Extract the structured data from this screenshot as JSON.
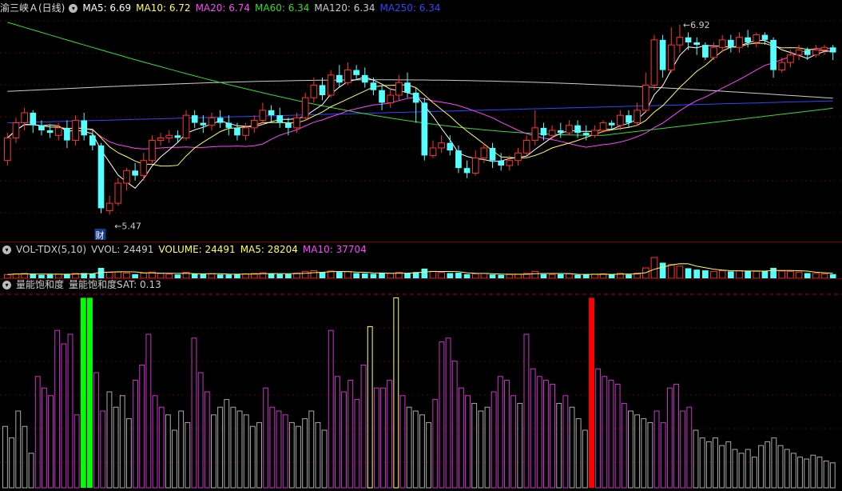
{
  "main_legend": {
    "stock": "渝三峡Ａ(日线)",
    "items": [
      {
        "label": "MA5: 6.69",
        "color": "#ffffff"
      },
      {
        "label": "MA10: 6.72",
        "color": "#ffff55"
      },
      {
        "label": "MA20: 6.74",
        "color": "#ff44ff"
      },
      {
        "label": "MA60: 6.34",
        "color": "#33dd33"
      },
      {
        "label": "MA120: 6.34",
        "color": "#cccccc"
      },
      {
        "label": "MA250: 6.34",
        "color": "#3344ff"
      }
    ]
  },
  "vol_legend": {
    "items": [
      {
        "label": "VOL-TDX(5,10)",
        "color": "#cccccc"
      },
      {
        "label": "VVOL: 24491",
        "color": "#cccccc"
      },
      {
        "label": "VOLUME: 24491",
        "color": "#ffff55"
      },
      {
        "label": "MA5: 28204",
        "color": "#ffff55"
      },
      {
        "label": "MA10: 37704",
        "color": "#ff44ff"
      }
    ]
  },
  "sat_legend": {
    "items": [
      {
        "label": "量能饱和度",
        "color": "#cccccc"
      },
      {
        "label": "量能饱和度SAT: 0.13",
        "color": "#cccccc"
      }
    ]
  },
  "annotations": {
    "high_label": "6.92",
    "low_label": "5.47",
    "cai_badge": "财"
  },
  "colors": {
    "up": "#ff3333",
    "down": "#55ffff",
    "ma5": "#ffffff",
    "ma10": "#ffff55",
    "ma20": "#ff44ff",
    "ma60": "#33dd33",
    "ma120": "#cccccc",
    "ma250": "#3344ff",
    "sat_magenta": "#cc33cc",
    "sat_gray": "#aaaaaa",
    "sat_yellow": "#ffff66",
    "sat_green": "#00ff00",
    "sat_red": "#ff0000"
  },
  "chart_data": {
    "type": "candlestick",
    "price_ylim": [
      5.3,
      7.05
    ],
    "candles": [
      [
        5.9,
        6.08,
        6.12,
        5.86
      ],
      [
        6.08,
        6.2,
        6.24,
        6.04
      ],
      [
        6.2,
        6.28,
        6.32,
        6.14
      ],
      [
        6.28,
        6.18,
        6.3,
        6.12
      ],
      [
        6.18,
        6.14,
        6.22,
        6.1
      ],
      [
        6.14,
        6.12,
        6.18,
        6.08
      ],
      [
        6.1,
        6.16,
        6.2,
        6.06
      ],
      [
        6.16,
        6.06,
        6.22,
        6.0
      ],
      [
        6.06,
        6.22,
        6.26,
        6.02
      ],
      [
        6.22,
        6.1,
        6.28,
        6.06
      ],
      [
        6.1,
        6.02,
        6.14,
        5.98
      ],
      [
        6.02,
        5.52,
        6.04,
        5.48
      ],
      [
        5.5,
        5.56,
        5.62,
        5.47
      ],
      [
        5.56,
        5.72,
        5.76,
        5.54
      ],
      [
        5.72,
        5.82,
        5.84,
        5.66
      ],
      [
        5.82,
        5.78,
        5.88,
        5.74
      ],
      [
        5.78,
        5.9,
        5.96,
        5.74
      ],
      [
        5.9,
        6.06,
        6.1,
        5.88
      ],
      [
        6.06,
        6.08,
        6.12,
        6.02
      ],
      [
        6.08,
        6.1,
        6.14,
        6.04
      ],
      [
        6.1,
        6.08,
        6.14,
        6.04
      ],
      [
        6.08,
        6.26,
        6.3,
        6.06
      ],
      [
        6.26,
        6.2,
        6.3,
        6.16
      ],
      [
        6.2,
        6.18,
        6.26,
        6.12
      ],
      [
        6.18,
        6.24,
        6.28,
        6.14
      ],
      [
        6.24,
        6.2,
        6.3,
        6.16
      ],
      [
        6.2,
        6.16,
        6.26,
        6.1
      ],
      [
        6.16,
        6.1,
        6.2,
        6.06
      ],
      [
        6.1,
        6.16,
        6.2,
        6.06
      ],
      [
        6.16,
        6.22,
        6.26,
        6.12
      ],
      [
        6.22,
        6.3,
        6.36,
        6.18
      ],
      [
        6.3,
        6.26,
        6.34,
        6.2
      ],
      [
        6.26,
        6.2,
        6.32,
        6.16
      ],
      [
        6.2,
        6.16,
        6.24,
        6.1
      ],
      [
        6.16,
        6.24,
        6.28,
        6.12
      ],
      [
        6.24,
        6.4,
        6.44,
        6.22
      ],
      [
        6.4,
        6.5,
        6.56,
        6.36
      ],
      [
        6.5,
        6.42,
        6.56,
        6.38
      ],
      [
        6.42,
        6.58,
        6.62,
        6.4
      ],
      [
        6.58,
        6.52,
        6.66,
        6.48
      ],
      [
        6.52,
        6.62,
        6.68,
        6.5
      ],
      [
        6.62,
        6.58,
        6.66,
        6.54
      ],
      [
        6.58,
        6.52,
        6.64,
        6.48
      ],
      [
        6.52,
        6.46,
        6.56,
        6.42
      ],
      [
        6.46,
        6.36,
        6.5,
        6.3
      ],
      [
        6.36,
        6.42,
        6.48,
        6.32
      ],
      [
        6.42,
        6.52,
        6.58,
        6.38
      ],
      [
        6.52,
        6.44,
        6.6,
        6.4
      ],
      [
        6.44,
        6.36,
        6.48,
        6.2
      ],
      [
        6.36,
        5.94,
        6.4,
        5.9
      ],
      [
        5.94,
        6.0,
        6.06,
        5.92
      ],
      [
        6.0,
        6.04,
        6.1,
        5.96
      ],
      [
        6.04,
        5.98,
        6.1,
        5.94
      ],
      [
        5.98,
        5.84,
        6.02,
        5.8
      ],
      [
        5.84,
        5.8,
        5.9,
        5.76
      ],
      [
        5.8,
        5.92,
        5.98,
        5.78
      ],
      [
        5.92,
        6.0,
        6.04,
        5.88
      ],
      [
        6.0,
        5.9,
        6.04,
        5.84
      ],
      [
        5.9,
        5.86,
        5.96,
        5.82
      ],
      [
        5.86,
        5.9,
        5.94,
        5.82
      ],
      [
        5.9,
        5.96,
        6.0,
        5.86
      ],
      [
        5.96,
        6.06,
        6.1,
        5.94
      ],
      [
        6.06,
        6.16,
        6.3,
        6.02
      ],
      [
        6.16,
        6.1,
        6.2,
        6.06
      ],
      [
        6.1,
        6.14,
        6.18,
        6.06
      ],
      [
        6.14,
        6.12,
        6.2,
        6.08
      ],
      [
        6.12,
        6.18,
        6.22,
        6.1
      ],
      [
        6.18,
        6.12,
        6.22,
        6.08
      ],
      [
        6.12,
        6.1,
        6.18,
        6.06
      ],
      [
        6.1,
        6.14,
        6.18,
        6.08
      ],
      [
        6.14,
        6.2,
        6.22,
        6.12
      ],
      [
        6.2,
        6.18,
        6.22,
        6.14
      ],
      [
        6.18,
        6.26,
        6.3,
        6.14
      ],
      [
        6.26,
        6.2,
        6.3,
        6.16
      ],
      [
        6.2,
        6.3,
        6.36,
        6.18
      ],
      [
        6.3,
        6.5,
        6.6,
        6.28
      ],
      [
        6.5,
        6.86,
        6.9,
        6.46
      ],
      [
        6.86,
        6.62,
        6.9,
        6.56
      ],
      [
        6.62,
        6.82,
        6.96,
        6.6
      ],
      [
        6.82,
        6.88,
        6.98,
        6.76
      ],
      [
        6.88,
        6.84,
        6.92,
        6.78
      ],
      [
        6.84,
        6.82,
        6.88,
        6.74
      ],
      [
        6.82,
        6.72,
        6.84,
        6.7
      ],
      [
        6.72,
        6.8,
        6.84,
        6.7
      ],
      [
        6.8,
        6.86,
        6.9,
        6.76
      ],
      [
        6.86,
        6.8,
        6.9,
        6.76
      ],
      [
        6.8,
        6.88,
        6.92,
        6.76
      ],
      [
        6.88,
        6.84,
        6.94,
        6.8
      ],
      [
        6.84,
        6.9,
        6.92,
        6.8
      ],
      [
        6.9,
        6.86,
        6.92,
        6.82
      ],
      [
        6.86,
        6.62,
        6.88,
        6.56
      ],
      [
        6.62,
        6.68,
        6.72,
        6.6
      ],
      [
        6.68,
        6.74,
        6.78,
        6.64
      ],
      [
        6.74,
        6.78,
        6.82,
        6.7
      ],
      [
        6.78,
        6.74,
        6.8,
        6.7
      ],
      [
        6.74,
        6.78,
        6.82,
        6.72
      ],
      [
        6.78,
        6.8,
        6.82,
        6.74
      ],
      [
        6.8,
        6.76,
        6.82,
        6.7
      ]
    ],
    "volume": [
      22,
      26,
      28,
      24,
      20,
      22,
      24,
      26,
      28,
      30,
      26,
      60,
      34,
      36,
      30,
      24,
      30,
      36,
      28,
      24,
      22,
      34,
      26,
      24,
      26,
      22,
      22,
      24,
      26,
      28,
      32,
      26,
      24,
      24,
      30,
      40,
      44,
      34,
      42,
      36,
      38,
      30,
      28,
      26,
      30,
      28,
      34,
      30,
      36,
      56,
      40,
      34,
      30,
      32,
      24,
      26,
      28,
      22,
      20,
      22,
      24,
      28,
      40,
      24,
      22,
      24,
      26,
      20,
      22,
      24,
      26,
      22,
      28,
      22,
      30,
      60,
      120,
      90,
      80,
      70,
      58,
      50,
      46,
      40,
      44,
      40,
      44,
      42,
      40,
      42,
      60,
      42,
      40,
      36,
      30,
      28,
      26,
      24
    ],
    "sat": [
      [
        0.32,
        "g"
      ],
      [
        0.26,
        "g"
      ],
      [
        0.4,
        "g"
      ],
      [
        0.32,
        "g"
      ],
      [
        0.18,
        "g"
      ],
      [
        0.58,
        "m"
      ],
      [
        0.52,
        "m"
      ],
      [
        0.48,
        "m"
      ],
      [
        0.82,
        "m"
      ],
      [
        0.75,
        "m"
      ],
      [
        0.8,
        "m"
      ],
      [
        0.38,
        "m"
      ],
      [
        0.99,
        "green"
      ],
      [
        0.99,
        "green"
      ],
      [
        0.6,
        "m"
      ],
      [
        0.4,
        "m"
      ],
      [
        0.5,
        "g"
      ],
      [
        0.42,
        "g"
      ],
      [
        0.48,
        "g"
      ],
      [
        0.36,
        "g"
      ],
      [
        0.56,
        "m"
      ],
      [
        0.64,
        "m"
      ],
      [
        0.8,
        "m"
      ],
      [
        0.48,
        "m"
      ],
      [
        0.42,
        "m"
      ],
      [
        0.38,
        "g"
      ],
      [
        0.3,
        "g"
      ],
      [
        0.4,
        "g"
      ],
      [
        0.34,
        "g"
      ],
      [
        0.78,
        "m"
      ],
      [
        0.6,
        "m"
      ],
      [
        0.5,
        "m"
      ],
      [
        0.38,
        "g"
      ],
      [
        0.42,
        "g"
      ],
      [
        0.46,
        "g"
      ],
      [
        0.42,
        "g"
      ],
      [
        0.4,
        "g"
      ],
      [
        0.38,
        "g"
      ],
      [
        0.32,
        "g"
      ],
      [
        0.34,
        "g"
      ],
      [
        0.52,
        "m"
      ],
      [
        0.42,
        "m"
      ],
      [
        0.4,
        "m"
      ],
      [
        0.38,
        "m"
      ],
      [
        0.34,
        "g"
      ],
      [
        0.32,
        "g"
      ],
      [
        0.36,
        "g"
      ],
      [
        0.4,
        "g"
      ],
      [
        0.34,
        "g"
      ],
      [
        0.3,
        "g"
      ],
      [
        0.82,
        "m"
      ],
      [
        0.58,
        "m"
      ],
      [
        0.5,
        "m"
      ],
      [
        0.56,
        "m"
      ],
      [
        0.46,
        "m"
      ],
      [
        0.64,
        "m"
      ],
      [
        0.84,
        "y"
      ],
      [
        0.52,
        "m"
      ],
      [
        0.52,
        "m"
      ],
      [
        0.56,
        "m"
      ],
      [
        0.99,
        "y"
      ],
      [
        0.48,
        "m"
      ],
      [
        0.42,
        "g"
      ],
      [
        0.4,
        "g"
      ],
      [
        0.38,
        "g"
      ],
      [
        0.34,
        "g"
      ],
      [
        0.46,
        "m"
      ],
      [
        0.76,
        "m"
      ],
      [
        0.78,
        "m"
      ],
      [
        0.66,
        "m"
      ],
      [
        0.52,
        "m"
      ],
      [
        0.48,
        "m"
      ],
      [
        0.44,
        "g"
      ],
      [
        0.4,
        "g"
      ],
      [
        0.42,
        "g"
      ],
      [
        0.5,
        "m"
      ],
      [
        0.58,
        "m"
      ],
      [
        0.56,
        "m"
      ],
      [
        0.48,
        "m"
      ],
      [
        0.44,
        "g"
      ],
      [
        0.8,
        "m"
      ],
      [
        0.62,
        "m"
      ],
      [
        0.58,
        "m"
      ],
      [
        0.56,
        "m"
      ],
      [
        0.54,
        "m"
      ],
      [
        0.44,
        "g"
      ],
      [
        0.48,
        "m"
      ],
      [
        0.42,
        "g"
      ],
      [
        0.36,
        "g"
      ],
      [
        0.3,
        "g"
      ],
      [
        0.99,
        "red"
      ],
      [
        0.62,
        "m"
      ],
      [
        0.58,
        "m"
      ],
      [
        0.56,
        "m"
      ],
      [
        0.54,
        "m"
      ],
      [
        0.44,
        "m"
      ],
      [
        0.4,
        "g"
      ],
      [
        0.38,
        "g"
      ],
      [
        0.36,
        "g"
      ],
      [
        0.34,
        "g"
      ],
      [
        0.4,
        "m"
      ],
      [
        0.34,
        "m"
      ],
      [
        0.52,
        "m"
      ],
      [
        0.54,
        "m"
      ],
      [
        0.4,
        "m"
      ],
      [
        0.42,
        "m"
      ],
      [
        0.3,
        "g"
      ],
      [
        0.26,
        "g"
      ],
      [
        0.24,
        "g"
      ],
      [
        0.26,
        "g"
      ],
      [
        0.22,
        "g"
      ],
      [
        0.24,
        "g"
      ],
      [
        0.2,
        "g"
      ],
      [
        0.18,
        "g"
      ],
      [
        0.2,
        "g"
      ],
      [
        0.16,
        "g"
      ],
      [
        0.22,
        "g"
      ],
      [
        0.24,
        "g"
      ],
      [
        0.26,
        "g"
      ],
      [
        0.22,
        "g"
      ],
      [
        0.2,
        "g"
      ],
      [
        0.18,
        "g"
      ],
      [
        0.16,
        "g"
      ],
      [
        0.15,
        "g"
      ],
      [
        0.17,
        "g"
      ],
      [
        0.16,
        "g"
      ],
      [
        0.14,
        "g"
      ],
      [
        0.13,
        "g"
      ]
    ],
    "sat_ylim": [
      0,
      1
    ]
  }
}
